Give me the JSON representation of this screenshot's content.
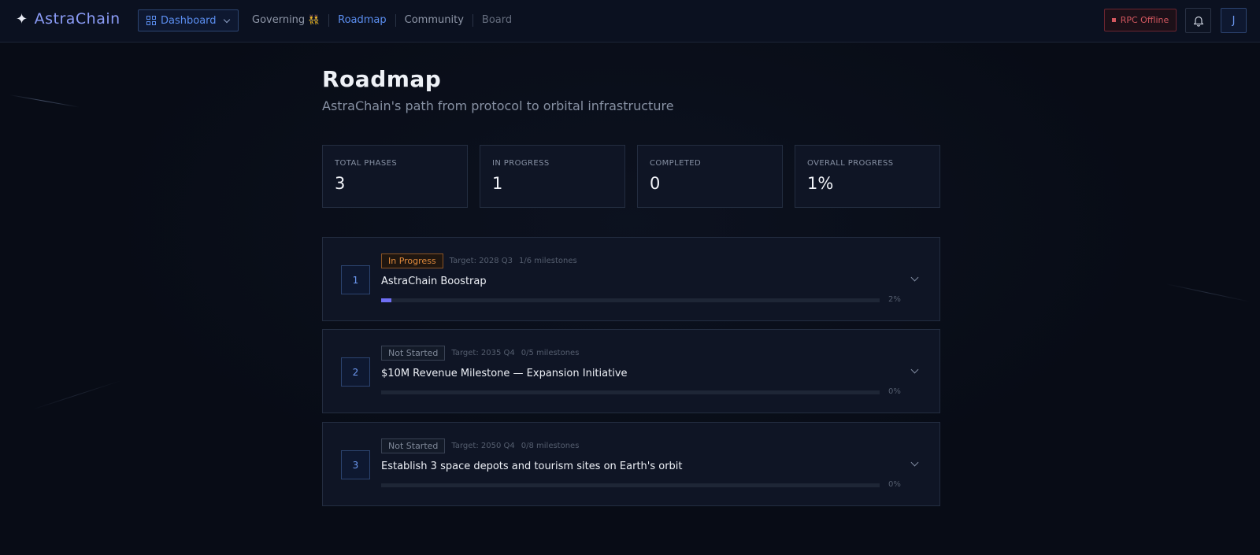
{
  "header": {
    "brand_icon": "✦",
    "brand": "AstraChain",
    "dashboard_label": "Dashboard",
    "nav": [
      {
        "label": "Governing",
        "emoji": "👯"
      },
      {
        "label": "Roadmap"
      },
      {
        "label": "Community"
      },
      {
        "label": "Board"
      }
    ],
    "rpc_status": "RPC Offline",
    "avatar_initial": "J"
  },
  "page": {
    "title": "Roadmap",
    "subtitle": "AstraChain's path from protocol to orbital infrastructure"
  },
  "stats": [
    {
      "label": "TOTAL PHASES",
      "value": "3"
    },
    {
      "label": "IN PROGRESS",
      "value": "1"
    },
    {
      "label": "COMPLETED",
      "value": "0"
    },
    {
      "label": "OVERALL PROGRESS",
      "value": "1%"
    }
  ],
  "phases": [
    {
      "number": "1",
      "status": "In Progress",
      "target": "Target: 2028 Q3",
      "milestones": "1/6 milestones",
      "title": "AstraChain Boostrap",
      "progress_pct": 2,
      "progress_label": "2%"
    },
    {
      "number": "2",
      "status": "Not Started",
      "target": "Target: 2035 Q4",
      "milestones": "0/5 milestones",
      "title": "$10M Revenue Milestone — Expansion Initiative",
      "progress_pct": 0,
      "progress_label": "0%"
    },
    {
      "number": "3",
      "status": "Not Started",
      "target": "Target: 2050 Q4",
      "milestones": "0/8 milestones",
      "title": "Establish 3 space depots and tourism sites on Earth's orbit",
      "progress_pct": 0,
      "progress_label": "0%"
    }
  ],
  "colors": {
    "accent": "#5b8ef0",
    "progress_fill": "#6f6ff5",
    "in_progress": "#e08a3c",
    "offline": "#d2575f"
  }
}
